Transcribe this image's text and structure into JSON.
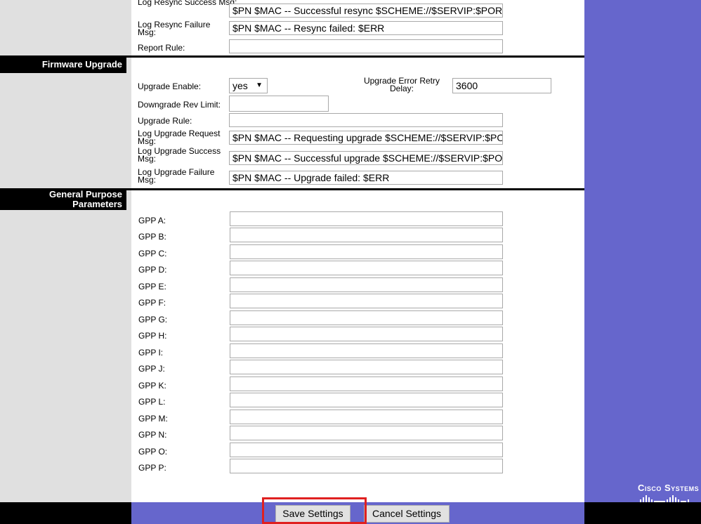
{
  "provisioning": {
    "log_resync_success_label": "Log Resync Success Msg:",
    "log_resync_success_value": "$PN $MAC -- Successful resync $SCHEME://$SERVIP:$PORT$PATH",
    "log_resync_failure_label": "Log Resync Failure Msg:",
    "log_resync_failure_value": "$PN $MAC -- Resync failed: $ERR",
    "report_rule_label": "Report Rule:",
    "report_rule_value": ""
  },
  "firmware": {
    "section_title": "Firmware Upgrade",
    "upgrade_enable_label": "Upgrade Enable:",
    "upgrade_enable_value": "yes",
    "retry_delay_label": "Upgrade Error Retry Delay:",
    "retry_delay_value": "3600",
    "downgrade_label": "Downgrade Rev Limit:",
    "downgrade_value": "",
    "upgrade_rule_label": "Upgrade Rule:",
    "upgrade_rule_value": "",
    "log_request_label": "Log Upgrade Request Msg:",
    "log_request_value": "$PN $MAC -- Requesting upgrade $SCHEME://$SERVIP:$PORT$PATH",
    "log_success_label": "Log Upgrade Success Msg:",
    "log_success_value": "$PN $MAC -- Successful upgrade $SCHEME://$SERVIP:$PORT$PATH",
    "log_failure_label": "Log Upgrade Failure Msg:",
    "log_failure_value": "$PN $MAC -- Upgrade failed: $ERR"
  },
  "gpp": {
    "section_title_line1": "General Purpose",
    "section_title_line2": "Parameters",
    "labels": [
      "GPP A:",
      "GPP B:",
      "GPP C:",
      "GPP D:",
      "GPP E:",
      "GPP F:",
      "GPP G:",
      "GPP H:",
      "GPP I:",
      "GPP J:",
      "GPP K:",
      "GPP L:",
      "GPP M:",
      "GPP N:",
      "GPP O:",
      "GPP P:"
    ]
  },
  "footer": {
    "save_label": "Save Settings",
    "cancel_label": "Cancel Settings",
    "brand": "Cisco Systems"
  },
  "colors": {
    "accent_blue": "#6666cc",
    "highlight_red": "#e02020"
  }
}
